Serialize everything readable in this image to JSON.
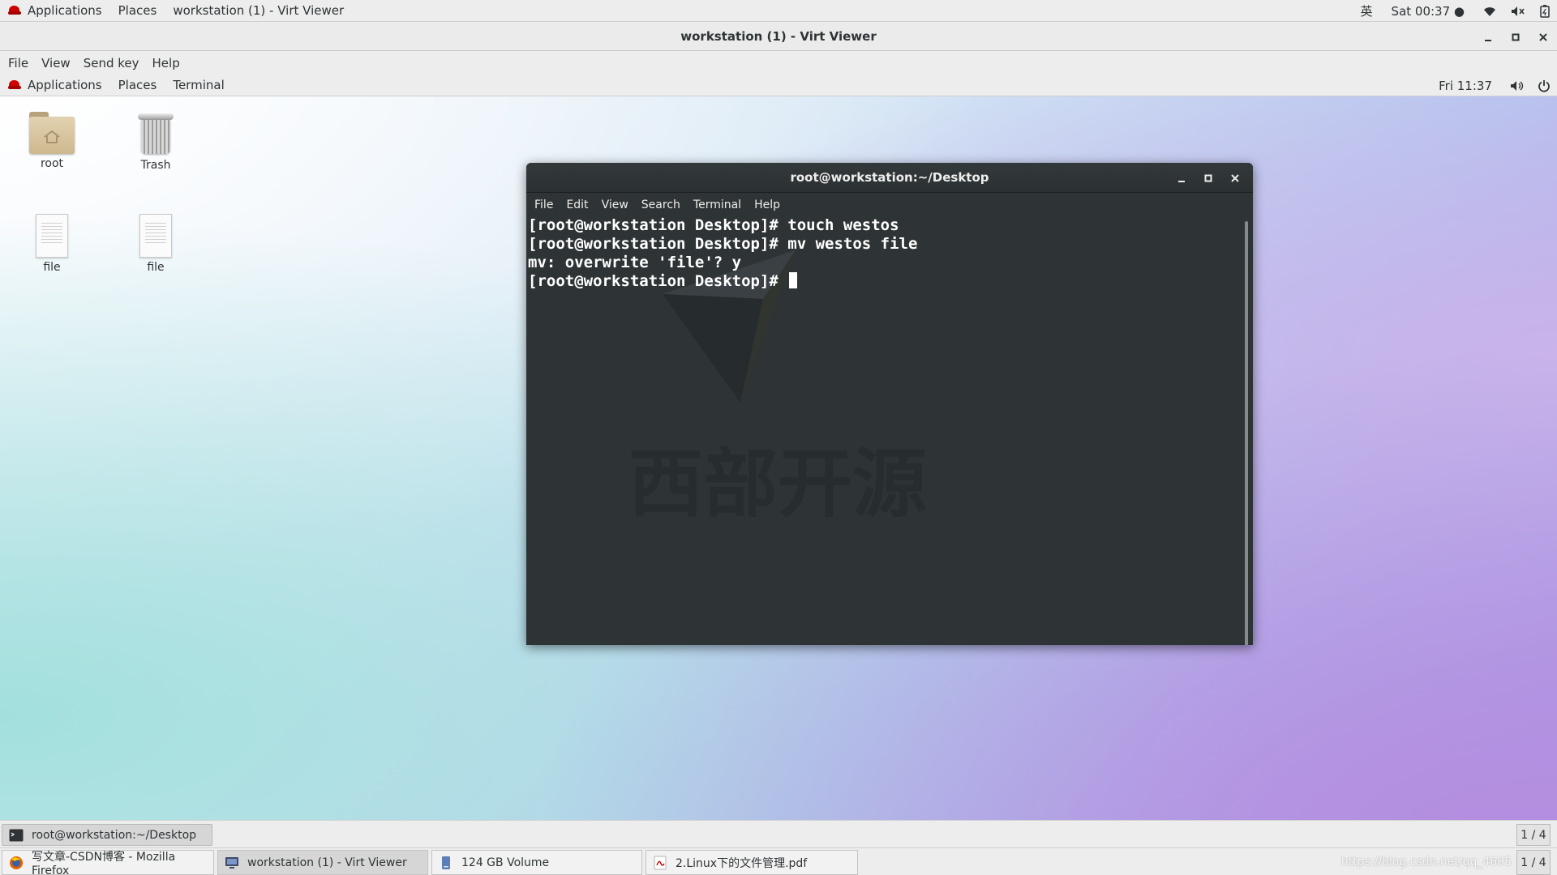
{
  "host_topbar": {
    "applications": "Applications",
    "places": "Places",
    "window_title": "workstation (1) - Virt Viewer",
    "input_method": "英",
    "clock": "Sat 00:37 ●"
  },
  "viewer": {
    "title": "workstation (1) - Virt Viewer",
    "menu": [
      "File",
      "View",
      "Send key",
      "Help"
    ]
  },
  "guest_topbar": {
    "applications": "Applications",
    "places": "Places",
    "terminal": "Terminal",
    "clock": "Fri 11:37"
  },
  "desktop_icons": [
    {
      "label": "root",
      "icon": "home-folder-icon"
    },
    {
      "label": "Trash",
      "icon": "trash-icon"
    },
    {
      "label": "file",
      "icon": "text-file-icon"
    },
    {
      "label": "file",
      "icon": "text-file-icon"
    }
  ],
  "terminal": {
    "title": "root@workstation:~/Desktop",
    "menu": [
      "File",
      "Edit",
      "View",
      "Search",
      "Terminal",
      "Help"
    ],
    "lines": [
      "[root@workstation Desktop]# touch westos",
      "[root@workstation Desktop]# mv westos file",
      "mv: overwrite 'file'? y",
      "[root@workstation Desktop]# "
    ],
    "watermark_text": "西部开源"
  },
  "guest_taskbar": {
    "tasks": [
      "root@workstation:~/Desktop"
    ],
    "pager": "1 / 4"
  },
  "host_taskbar": {
    "tasks": [
      {
        "label": "写文章-CSDN博客 - Mozilla Firefox",
        "icon": "firefox-icon"
      },
      {
        "label": "workstation (1) - Virt Viewer",
        "icon": "virt-viewer-icon"
      },
      {
        "label": "124 GB Volume",
        "icon": "drive-icon"
      },
      {
        "label": "2.Linux下的文件管理.pdf",
        "icon": "pdf-icon"
      }
    ],
    "pager": "1 / 4",
    "watermark_url": "https://blog.csdn.net/qq_4605"
  },
  "colors": {
    "terminal_bg": "#2e3436",
    "panel_bg": "#ededed",
    "redhat_red": "#cc0000"
  }
}
